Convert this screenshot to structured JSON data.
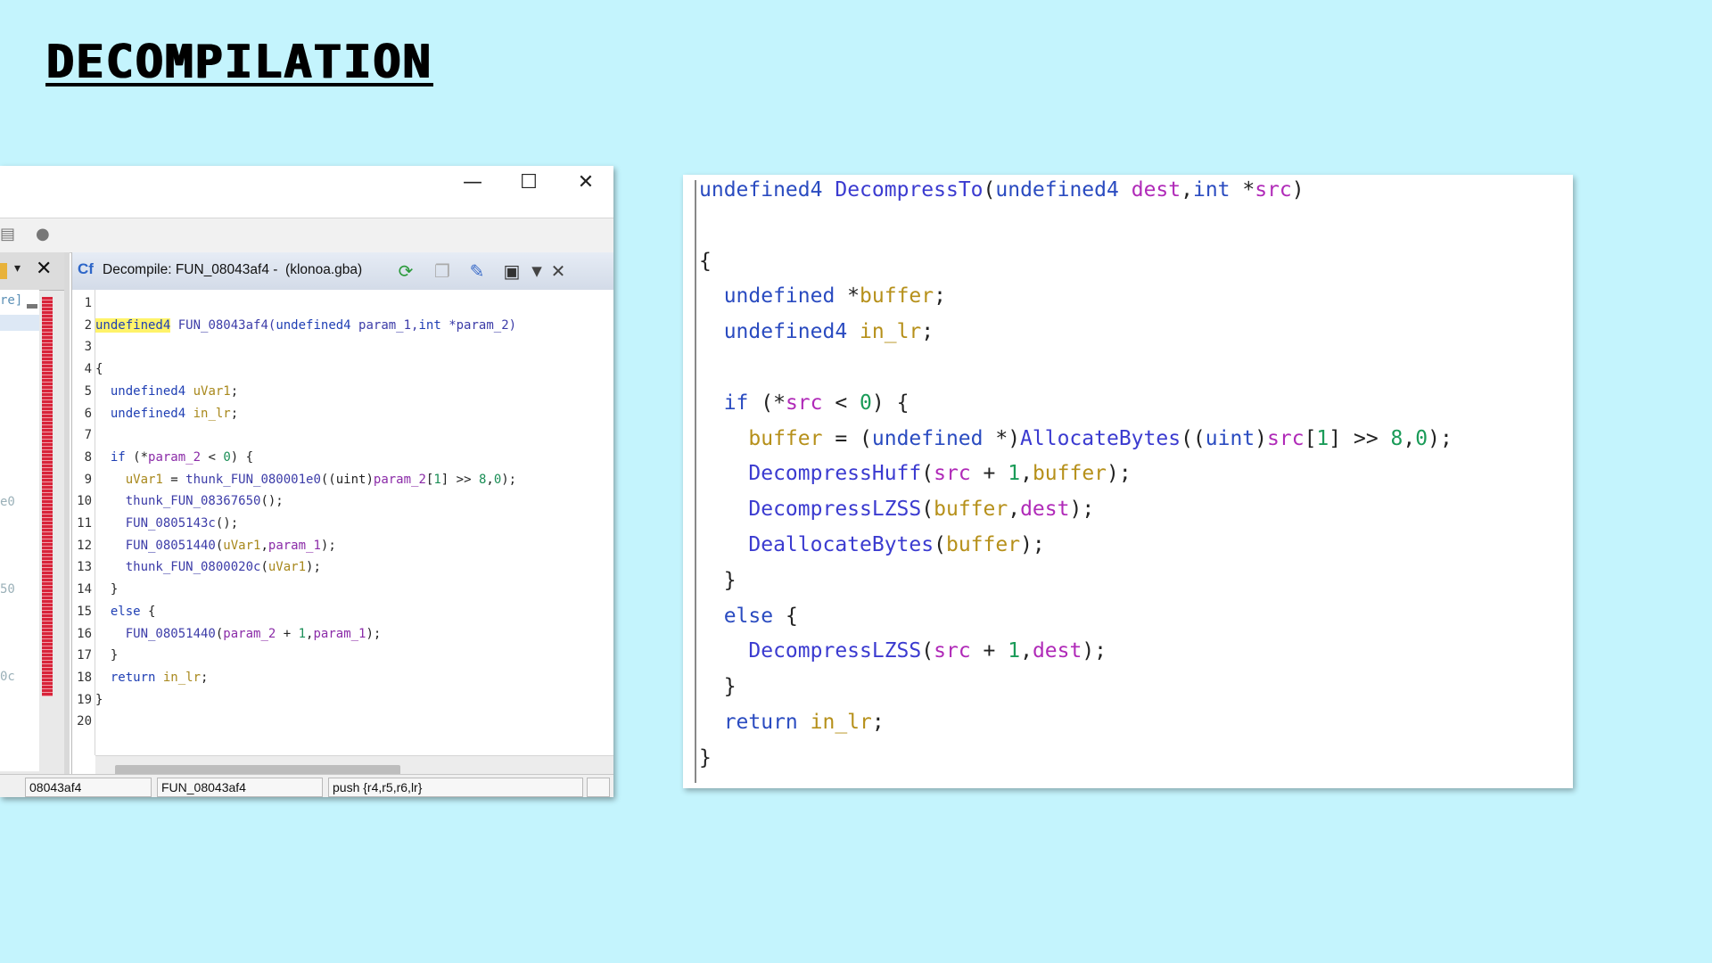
{
  "slide": {
    "title": "DECOMPILATION"
  },
  "ghidra": {
    "window_controls": {
      "minimize": "—",
      "maximize": "☐",
      "close": "✕"
    },
    "left_fragments": [
      "re]",
      "e0",
      "50",
      "0c"
    ],
    "tab": {
      "icon_text": "Cf",
      "title": "Decompile: FUN_08043af4 -  (klonoa.gba)"
    },
    "line_numbers": [
      "1",
      "2",
      "3",
      "4",
      "5",
      "6",
      "7",
      "8",
      "9",
      "10",
      "11",
      "12",
      "13",
      "14",
      "15",
      "16",
      "17",
      "18",
      "19",
      "20"
    ],
    "code": [
      [],
      [
        {
          "t": "undefined4",
          "c": "kw hl"
        },
        {
          "t": " FUN_08043af4(",
          "c": "fn"
        },
        {
          "t": "undefined4",
          "c": "kw"
        },
        {
          "t": " param_1,",
          "c": "fn"
        },
        {
          "t": "int",
          "c": "kw"
        },
        {
          "t": " *param_2)",
          "c": "fn"
        }
      ],
      [],
      [
        {
          "t": "{",
          "c": ""
        }
      ],
      [
        {
          "t": "  undefined4",
          "c": "kw"
        },
        {
          "t": " uVar1",
          "c": "var"
        },
        {
          "t": ";",
          "c": ""
        }
      ],
      [
        {
          "t": "  undefined4",
          "c": "kw"
        },
        {
          "t": " in_lr",
          "c": "var"
        },
        {
          "t": ";",
          "c": ""
        }
      ],
      [],
      [
        {
          "t": "  if",
          "c": "kw"
        },
        {
          "t": " (*",
          "c": ""
        },
        {
          "t": "param_2",
          "c": "prm"
        },
        {
          "t": " < ",
          "c": ""
        },
        {
          "t": "0",
          "c": "num"
        },
        {
          "t": ") {",
          "c": ""
        }
      ],
      [
        {
          "t": "    uVar1",
          "c": "var"
        },
        {
          "t": " = ",
          "c": ""
        },
        {
          "t": "thunk_FUN_080001e0",
          "c": "fn"
        },
        {
          "t": "((uint)",
          "c": ""
        },
        {
          "t": "param_2",
          "c": "prm"
        },
        {
          "t": "[",
          "c": ""
        },
        {
          "t": "1",
          "c": "num"
        },
        {
          "t": "] >> ",
          "c": ""
        },
        {
          "t": "8",
          "c": "num"
        },
        {
          "t": ",",
          "c": ""
        },
        {
          "t": "0",
          "c": "num"
        },
        {
          "t": ");",
          "c": ""
        }
      ],
      [
        {
          "t": "    thunk_FUN_08367650",
          "c": "fn"
        },
        {
          "t": "();",
          "c": ""
        }
      ],
      [
        {
          "t": "    FUN_0805143c",
          "c": "fn"
        },
        {
          "t": "();",
          "c": ""
        }
      ],
      [
        {
          "t": "    FUN_08051440",
          "c": "fn"
        },
        {
          "t": "(",
          "c": ""
        },
        {
          "t": "uVar1",
          "c": "var"
        },
        {
          "t": ",",
          "c": ""
        },
        {
          "t": "param_1",
          "c": "prm"
        },
        {
          "t": ");",
          "c": ""
        }
      ],
      [
        {
          "t": "    thunk_FUN_0800020c",
          "c": "fn"
        },
        {
          "t": "(",
          "c": ""
        },
        {
          "t": "uVar1",
          "c": "var"
        },
        {
          "t": ");",
          "c": ""
        }
      ],
      [
        {
          "t": "  }",
          "c": ""
        }
      ],
      [
        {
          "t": "  else",
          "c": "kw"
        },
        {
          "t": " {",
          "c": ""
        }
      ],
      [
        {
          "t": "    FUN_08051440",
          "c": "fn"
        },
        {
          "t": "(",
          "c": ""
        },
        {
          "t": "param_2",
          "c": "prm"
        },
        {
          "t": " + ",
          "c": ""
        },
        {
          "t": "1",
          "c": "num"
        },
        {
          "t": ",",
          "c": ""
        },
        {
          "t": "param_1",
          "c": "prm"
        },
        {
          "t": ");",
          "c": ""
        }
      ],
      [
        {
          "t": "  }",
          "c": ""
        }
      ],
      [
        {
          "t": "  return",
          "c": "kw"
        },
        {
          "t": " in_lr",
          "c": "var"
        },
        {
          "t": ";",
          "c": ""
        }
      ],
      [
        {
          "t": "}",
          "c": ""
        }
      ],
      []
    ],
    "status": {
      "address": "08043af4",
      "function": "FUN_08043af4",
      "instruction": "push {r4,r5,r6,lr}"
    }
  },
  "clean_code": [
    [
      {
        "t": "undefined4",
        "c": "c-kw"
      },
      {
        "t": " ",
        "c": ""
      },
      {
        "t": "DecompressTo",
        "c": "c-fn"
      },
      {
        "t": "(",
        "c": ""
      },
      {
        "t": "undefined4",
        "c": "c-kw"
      },
      {
        "t": " ",
        "c": ""
      },
      {
        "t": "dest",
        "c": "c-prm"
      },
      {
        "t": ",",
        "c": ""
      },
      {
        "t": "int",
        "c": "c-kw"
      },
      {
        "t": " *",
        "c": ""
      },
      {
        "t": "src",
        "c": "c-prm"
      },
      {
        "t": ")",
        "c": ""
      }
    ],
    [],
    [
      {
        "t": "{",
        "c": ""
      }
    ],
    [
      {
        "t": "  undefined",
        "c": "c-kw"
      },
      {
        "t": " *",
        "c": ""
      },
      {
        "t": "buffer",
        "c": "c-var"
      },
      {
        "t": ";",
        "c": ""
      }
    ],
    [
      {
        "t": "  undefined4",
        "c": "c-kw"
      },
      {
        "t": " ",
        "c": ""
      },
      {
        "t": "in_lr",
        "c": "c-var"
      },
      {
        "t": ";",
        "c": ""
      }
    ],
    [],
    [
      {
        "t": "  if",
        "c": "c-kw"
      },
      {
        "t": " (*",
        "c": ""
      },
      {
        "t": "src",
        "c": "c-prm"
      },
      {
        "t": " < ",
        "c": ""
      },
      {
        "t": "0",
        "c": "c-num"
      },
      {
        "t": ") {",
        "c": ""
      }
    ],
    [
      {
        "t": "    buffer",
        "c": "c-var"
      },
      {
        "t": " = (",
        "c": ""
      },
      {
        "t": "undefined",
        "c": "c-kw"
      },
      {
        "t": " *)",
        "c": ""
      },
      {
        "t": "AllocateBytes",
        "c": "c-fn"
      },
      {
        "t": "((",
        "c": ""
      },
      {
        "t": "uint",
        "c": "c-kw"
      },
      {
        "t": ")",
        "c": ""
      },
      {
        "t": "src",
        "c": "c-prm"
      },
      {
        "t": "[",
        "c": ""
      },
      {
        "t": "1",
        "c": "c-num"
      },
      {
        "t": "] >> ",
        "c": ""
      },
      {
        "t": "8",
        "c": "c-num"
      },
      {
        "t": ",",
        "c": ""
      },
      {
        "t": "0",
        "c": "c-num"
      },
      {
        "t": ");",
        "c": ""
      }
    ],
    [
      {
        "t": "    ",
        "c": ""
      },
      {
        "t": "DecompressHuff",
        "c": "c-fn"
      },
      {
        "t": "(",
        "c": ""
      },
      {
        "t": "src",
        "c": "c-prm"
      },
      {
        "t": " + ",
        "c": ""
      },
      {
        "t": "1",
        "c": "c-num"
      },
      {
        "t": ",",
        "c": ""
      },
      {
        "t": "buffer",
        "c": "c-var"
      },
      {
        "t": ");",
        "c": ""
      }
    ],
    [
      {
        "t": "    ",
        "c": ""
      },
      {
        "t": "DecompressLZSS",
        "c": "c-fn"
      },
      {
        "t": "(",
        "c": ""
      },
      {
        "t": "buffer",
        "c": "c-var"
      },
      {
        "t": ",",
        "c": ""
      },
      {
        "t": "dest",
        "c": "c-prm"
      },
      {
        "t": ");",
        "c": ""
      }
    ],
    [
      {
        "t": "    ",
        "c": ""
      },
      {
        "t": "DeallocateBytes",
        "c": "c-fn"
      },
      {
        "t": "(",
        "c": ""
      },
      {
        "t": "buffer",
        "c": "c-var"
      },
      {
        "t": ");",
        "c": ""
      }
    ],
    [
      {
        "t": "  }",
        "c": ""
      }
    ],
    [
      {
        "t": "  else",
        "c": "c-kw"
      },
      {
        "t": " {",
        "c": ""
      }
    ],
    [
      {
        "t": "    ",
        "c": ""
      },
      {
        "t": "DecompressLZSS",
        "c": "c-fn"
      },
      {
        "t": "(",
        "c": ""
      },
      {
        "t": "src",
        "c": "c-prm"
      },
      {
        "t": " + ",
        "c": ""
      },
      {
        "t": "1",
        "c": "c-num"
      },
      {
        "t": ",",
        "c": ""
      },
      {
        "t": "dest",
        "c": "c-prm"
      },
      {
        "t": ");",
        "c": ""
      }
    ],
    [
      {
        "t": "  }",
        "c": ""
      }
    ],
    [
      {
        "t": "  return",
        "c": "c-kw"
      },
      {
        "t": " ",
        "c": ""
      },
      {
        "t": "in_lr",
        "c": "c-var"
      },
      {
        "t": ";",
        "c": ""
      }
    ],
    [
      {
        "t": "}",
        "c": ""
      }
    ]
  ]
}
